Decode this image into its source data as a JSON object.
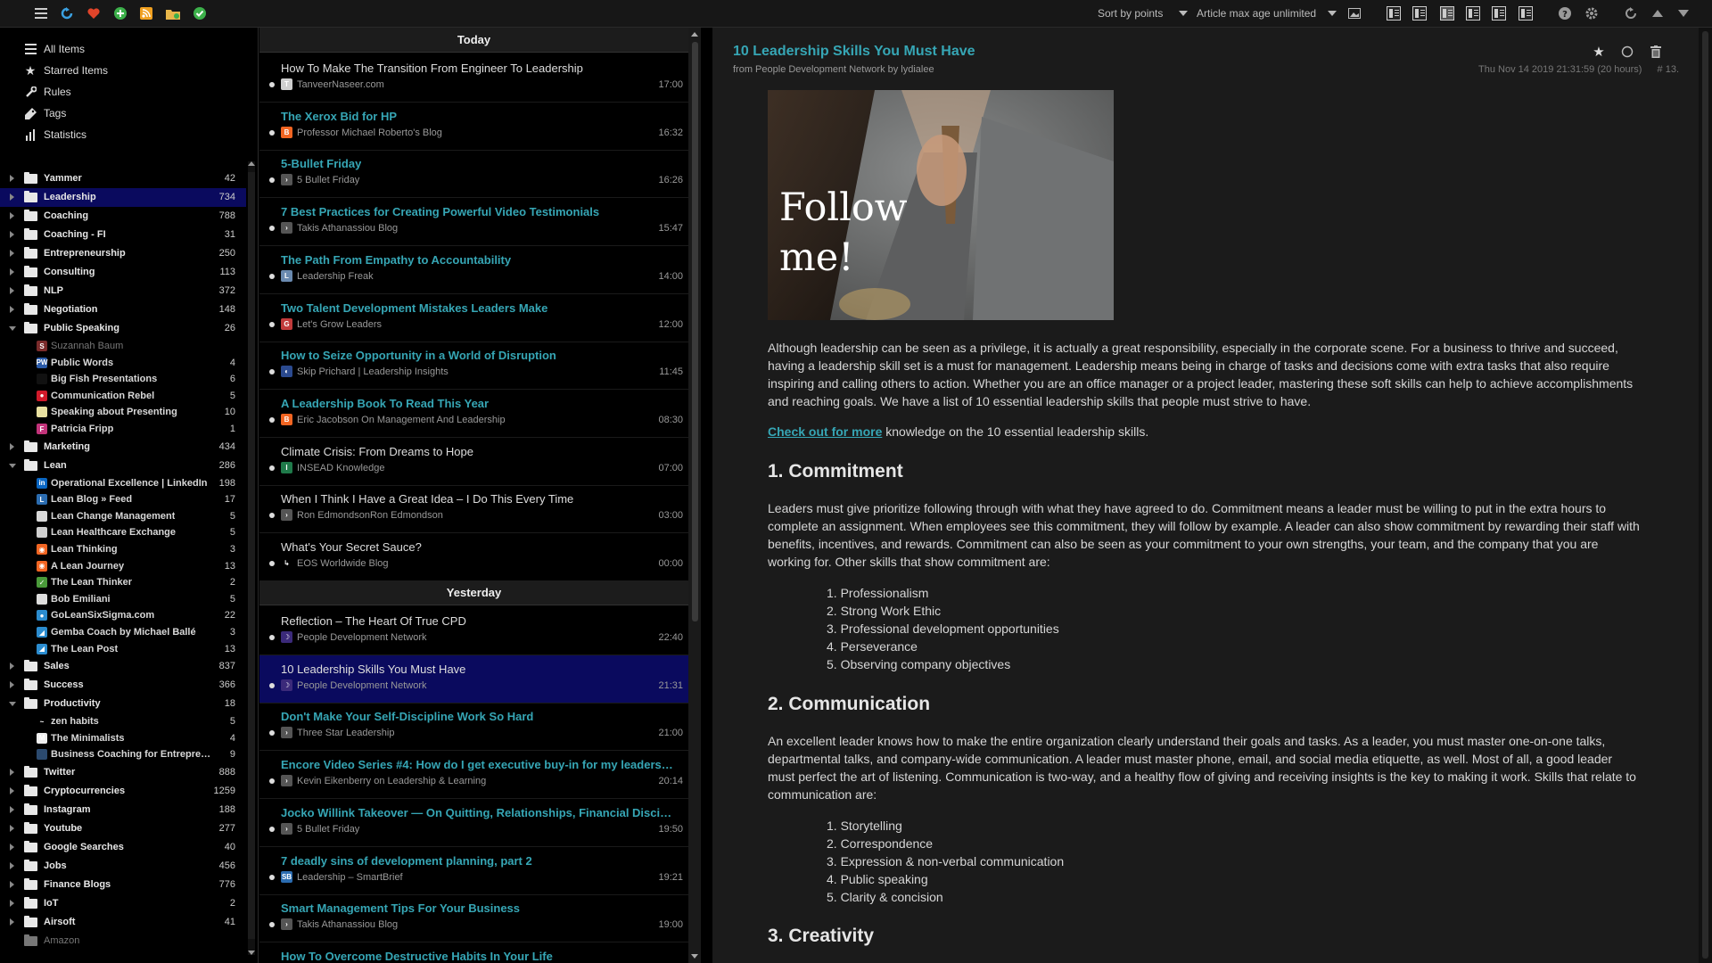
{
  "toolbar": {
    "sort_label": "Sort by points",
    "age_label": "Article max age unlimited"
  },
  "nav": [
    {
      "label": "All Items",
      "icon": "list-icon"
    },
    {
      "label": "Starred Items",
      "icon": "star-icon"
    },
    {
      "label": "Rules",
      "icon": "wrench-icon"
    },
    {
      "label": "Tags",
      "icon": "tag-icon"
    },
    {
      "label": "Statistics",
      "icon": "bar-chart-icon"
    }
  ],
  "tree": [
    {
      "kind": "folder",
      "label": "Yammer",
      "count": "42",
      "state": "closed"
    },
    {
      "kind": "folder",
      "label": "Leadership",
      "count": "734",
      "state": "closed",
      "selected": true
    },
    {
      "kind": "folder",
      "label": "Coaching",
      "count": "788",
      "state": "closed"
    },
    {
      "kind": "folder",
      "label": "Coaching - FI",
      "count": "31",
      "state": "closed"
    },
    {
      "kind": "folder",
      "label": "Entrepreneurship",
      "count": "250",
      "state": "closed"
    },
    {
      "kind": "folder",
      "label": "Consulting",
      "count": "113",
      "state": "closed"
    },
    {
      "kind": "folder",
      "label": "NLP",
      "count": "372",
      "state": "closed"
    },
    {
      "kind": "folder",
      "label": "Negotiation",
      "count": "148",
      "state": "closed"
    },
    {
      "kind": "folder",
      "label": "Public Speaking",
      "count": "26",
      "state": "open"
    },
    {
      "kind": "feed",
      "label": "Suzannah Baum",
      "count": "",
      "color": "#7a2b2b",
      "glyph": "S",
      "dim": true
    },
    {
      "kind": "feed",
      "label": "Public Words",
      "count": "4",
      "color": "#2a5aa8",
      "glyph": "PW"
    },
    {
      "kind": "feed",
      "label": "Big Fish Presentations",
      "count": "6",
      "color": "#111111",
      "glyph": ""
    },
    {
      "kind": "feed",
      "label": "Communication Rebel",
      "count": "5",
      "color": "#d11a2a",
      "glyph": "●"
    },
    {
      "kind": "feed",
      "label": "Speaking about Presenting",
      "count": "10",
      "color": "#e8e0a0",
      "glyph": ""
    },
    {
      "kind": "feed",
      "label": "Patricia Fripp",
      "count": "1",
      "color": "#c2337a",
      "glyph": "F"
    },
    {
      "kind": "folder",
      "label": "Marketing",
      "count": "434",
      "state": "closed"
    },
    {
      "kind": "folder",
      "label": "Lean",
      "count": "286",
      "state": "open"
    },
    {
      "kind": "feed",
      "label": "Operational Excellence | LinkedIn",
      "count": "198",
      "color": "#0a66c2",
      "glyph": "in"
    },
    {
      "kind": "feed",
      "label": "Lean Blog » Feed",
      "count": "17",
      "color": "#2b6cb0",
      "glyph": "L"
    },
    {
      "kind": "feed",
      "label": "Lean Change Management",
      "count": "5",
      "color": "#d8d8d8",
      "glyph": ""
    },
    {
      "kind": "feed",
      "label": "Lean Healthcare Exchange",
      "count": "5",
      "color": "#cfcfcf",
      "glyph": ""
    },
    {
      "kind": "feed",
      "label": "Lean Thinking",
      "count": "3",
      "color": "#f26522",
      "glyph": "◉"
    },
    {
      "kind": "feed",
      "label": "A Lean Journey",
      "count": "13",
      "color": "#f26522",
      "glyph": "◉"
    },
    {
      "kind": "feed",
      "label": "The Lean Thinker",
      "count": "2",
      "color": "#4a9a3a",
      "glyph": "✓"
    },
    {
      "kind": "feed",
      "label": "Bob Emiliani",
      "count": "5",
      "color": "#dddddd",
      "glyph": ""
    },
    {
      "kind": "feed",
      "label": "GoLeanSixSigma.com",
      "count": "22",
      "color": "#2b8ccf",
      "glyph": "●"
    },
    {
      "kind": "feed",
      "label": "Gemba Coach by Michael Ballé",
      "count": "3",
      "color": "#2b8ccf",
      "glyph": "◢"
    },
    {
      "kind": "feed",
      "label": "The Lean Post",
      "count": "13",
      "color": "#2b8ccf",
      "glyph": "◢"
    },
    {
      "kind": "folder",
      "label": "Sales",
      "count": "837",
      "state": "closed"
    },
    {
      "kind": "folder",
      "label": "Success",
      "count": "366",
      "state": "closed"
    },
    {
      "kind": "folder",
      "label": "Productivity",
      "count": "18",
      "state": "open"
    },
    {
      "kind": "feed",
      "label": "zen habits",
      "count": "5",
      "color": "#000000",
      "glyph": "~"
    },
    {
      "kind": "feed",
      "label": "The Minimalists",
      "count": "4",
      "color": "#eeeeee",
      "glyph": "M"
    },
    {
      "kind": "feed",
      "label": "Business Coaching for Entreprene...",
      "count": "9",
      "color": "#2b4a6f",
      "glyph": ""
    },
    {
      "kind": "folder",
      "label": "Twitter",
      "count": "888",
      "state": "closed"
    },
    {
      "kind": "folder",
      "label": "Cryptocurrencies",
      "count": "1259",
      "state": "closed"
    },
    {
      "kind": "folder",
      "label": "Instagram",
      "count": "188",
      "state": "closed"
    },
    {
      "kind": "folder",
      "label": "Youtube",
      "count": "277",
      "state": "closed"
    },
    {
      "kind": "folder",
      "label": "Google Searches",
      "count": "40",
      "state": "closed"
    },
    {
      "kind": "folder",
      "label": "Jobs",
      "count": "456",
      "state": "closed"
    },
    {
      "kind": "folder",
      "label": "Finance Blogs",
      "count": "776",
      "state": "closed"
    },
    {
      "kind": "folder",
      "label": "IoT",
      "count": "2",
      "state": "closed"
    },
    {
      "kind": "folder",
      "label": "Airsoft",
      "count": "41",
      "state": "closed"
    },
    {
      "kind": "folder",
      "label": "Amazon",
      "count": "",
      "state": "none",
      "dim": true
    }
  ],
  "list": {
    "today_label": "Today",
    "yesterday_label": "Yesterday",
    "today": [
      {
        "title": "How To Make The Transition From Engineer To Leadership",
        "source": "TanveerNaseer.com",
        "time": "17:00",
        "unread": false,
        "color": "#cfcfcf",
        "glyph": "T"
      },
      {
        "title": "The Xerox Bid for HP",
        "source": "Professor Michael Roberto's Blog",
        "time": "16:32",
        "unread": true,
        "color": "#f26522",
        "glyph": "B"
      },
      {
        "title": "5-Bullet Friday",
        "source": "5 Bullet Friday",
        "time": "16:26",
        "unread": true,
        "color": "#555555",
        "glyph": "›"
      },
      {
        "title": "7 Best Practices for Creating Powerful Video Testimonials",
        "source": "Takis Athanassiou Blog",
        "time": "15:47",
        "unread": true,
        "color": "#555555",
        "glyph": "›"
      },
      {
        "title": "The Path From Empathy to Accountability",
        "source": "Leadership Freak",
        "time": "14:00",
        "unread": true,
        "color": "#6a8ab0",
        "glyph": "L"
      },
      {
        "title": "Two Talent Development Mistakes Leaders Make",
        "source": "Let's Grow Leaders",
        "time": "12:00",
        "unread": true,
        "color": "#c23b3b",
        "glyph": "G"
      },
      {
        "title": "How to Seize Opportunity in a World of Disruption",
        "source": "Skip Prichard | Leadership Insights",
        "time": "11:45",
        "unread": true,
        "color": "#2b4a8f",
        "glyph": "◐"
      },
      {
        "title": "A Leadership Book To Read This Year",
        "source": "Eric Jacobson On Management And Leadership",
        "time": "08:30",
        "unread": true,
        "color": "#f26522",
        "glyph": "B"
      },
      {
        "title": "Climate Crisis: From Dreams to Hope",
        "source": "INSEAD Knowledge",
        "time": "07:00",
        "unread": false,
        "color": "#1f7a4a",
        "glyph": "I"
      },
      {
        "title": "When I Think I Have a Great Idea – I Do This Every Time",
        "source": "Ron EdmondsonRon Edmondson",
        "time": "03:00",
        "unread": false,
        "color": "#555555",
        "glyph": "›"
      },
      {
        "title": "What's Your Secret Sauce?",
        "source": "EOS Worldwide Blog",
        "time": "00:00",
        "unread": false,
        "color": "#000000",
        "glyph": "↳"
      }
    ],
    "yesterday": [
      {
        "title": "Reflection – The Heart Of True CPD",
        "source": "People Development Network",
        "time": "22:40",
        "unread": false,
        "color": "#3b2a7a",
        "glyph": "☽"
      },
      {
        "title": "10 Leadership Skills You Must Have",
        "source": "People Development Network",
        "time": "21:31",
        "unread": false,
        "selected": true,
        "color": "#3b2a7a",
        "glyph": "☽"
      },
      {
        "title": "Don't Make Your Self-Discipline Work So Hard",
        "source": "Three Star Leadership",
        "time": "21:00",
        "unread": true,
        "color": "#555555",
        "glyph": "›"
      },
      {
        "title": "Encore Video Series #4: How do I get executive buy-in for my leadershi...",
        "source": "Kevin Eikenberry on Leadership & Learning",
        "time": "20:14",
        "unread": true,
        "color": "#555555",
        "glyph": "›"
      },
      {
        "title": "Jocko Willink Takeover — On Quitting, Relationships, Financial Disciplin...",
        "source": "5 Bullet Friday",
        "time": "19:50",
        "unread": true,
        "color": "#555555",
        "glyph": "›"
      },
      {
        "title": "7 deadly sins of development planning, part 2",
        "source": "Leadership – SmartBrief",
        "time": "19:21",
        "unread": true,
        "color": "#2b6cb0",
        "glyph": "SB"
      },
      {
        "title": "Smart Management Tips For Your Business",
        "source": "Takis Athanassiou Blog",
        "time": "19:00",
        "unread": true,
        "color": "#555555",
        "glyph": "›"
      },
      {
        "title": "How To Overcome Destructive Habits In Your Life",
        "source": "",
        "time": "",
        "unread": true,
        "color": "#555555",
        "glyph": ""
      }
    ]
  },
  "article": {
    "title": "10 Leadership Skills You Must Have",
    "from": "from People Development Network by lydialee",
    "date": "Thu Nov 14 2019 21:31:59 (20 hours)",
    "number": "# 13.",
    "image_text_1": "Follow",
    "image_text_2": "me!",
    "intro": "Although leadership can be seen as a privilege, it is actually a great responsibility, especially in the corporate scene. For a business to thrive and succeed, having a leadership skill set is a must for management. Leadership means being in charge of tasks and decisions come with extra tasks that also require inspiring and calling others to action. Whether you are an office manager or a project leader, mastering these soft skills can help to achieve accomplishments and reaching goals. We have a list of 10 essential leadership skills that people must strive to have.",
    "link_text": "Check out for more",
    "link_after": " knowledge on the 10 essential leadership skills.",
    "h1": "1. Commitment",
    "p1": "Leaders must give prioritize following through with what they have agreed to do. Commitment means a leader must be willing to put in the extra hours to complete an assignment. When employees see this commitment, they will follow by example. A leader can also show commitment by rewarding their staff with benefits, incentives, and rewards. Commitment can also be seen as your commitment to your own strengths, your team, and the company that you are working for. Other skills that show commitment are:",
    "list1": [
      "1. Professionalism",
      "2. Strong Work Ethic",
      "3. Professional development opportunities",
      "4. Perseverance",
      "5. Observing company objectives"
    ],
    "h2": "2. Communication",
    "p2": "An excellent leader knows how to make the entire organization clearly understand their goals and tasks. As a leader, you must master one-on-one talks, departmental talks, and company-wide communication. A leader must master phone, email, and social media etiquette, as well. Most of all, a good leader must perfect the art of listening. Communication is two-way, and a healthy flow of giving and receiving insights is the key to making it work. Skills that relate to communication are:",
    "list2": [
      "1. Storytelling",
      "2. Correspondence",
      "3. Expression & non-verbal communication",
      "4. Public speaking",
      "5. Clarity & concision"
    ],
    "h3": "3. Creativity"
  },
  "colors": {
    "accent": "#36a6b5",
    "selection": "#0a0a5e",
    "pane_bg": "#1b1b1b"
  }
}
